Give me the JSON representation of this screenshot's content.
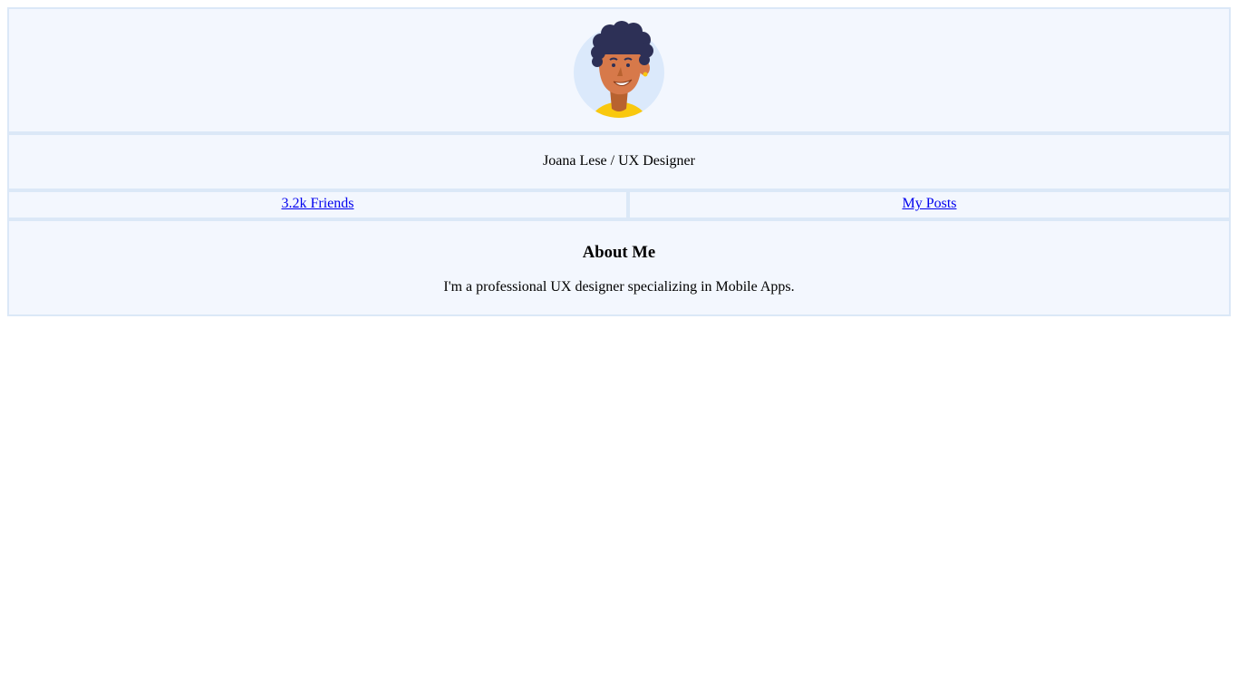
{
  "profile": {
    "avatar_icon": "person-avatar-icon",
    "name": "Joana Lese",
    "separator": "/",
    "role": "UX Designer"
  },
  "links": {
    "friends": "3.2k Friends",
    "posts": "My Posts"
  },
  "about": {
    "title": "About Me",
    "text": "I'm a professional UX designer specializing in Mobile Apps."
  },
  "colors": {
    "border": "#dbe8f7",
    "cell_background": "#f3f7fe",
    "link": "#0000ee",
    "avatar_circle": "#dbe9fb",
    "hair": "#2d3056",
    "skin": "#d7794a",
    "shirt": "#f9c80e"
  }
}
